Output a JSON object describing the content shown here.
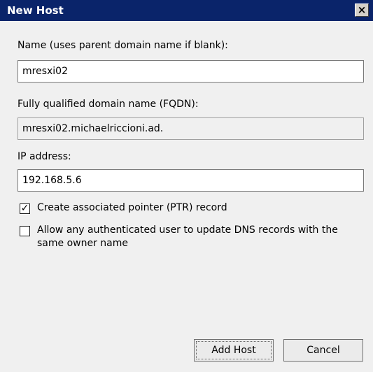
{
  "window": {
    "title": "New Host",
    "close_label": "×"
  },
  "form": {
    "name_label": "Name (uses parent domain name if blank):",
    "name_value": "mresxi02",
    "fqdn_label": "Fully qualified domain name (FQDN):",
    "fqdn_value": "mresxi02.michaelriccioni.ad.",
    "ip_label": "IP address:",
    "ip_value": "192.168.5.6",
    "ptr_label": "Create associated pointer (PTR) record",
    "ptr_checked": true,
    "ptr_mark": "✓",
    "allow_label": "Allow any authenticated user to update DNS records with the same owner name",
    "allow_checked": false
  },
  "buttons": {
    "add_host": "Add Host",
    "cancel": "Cancel"
  }
}
